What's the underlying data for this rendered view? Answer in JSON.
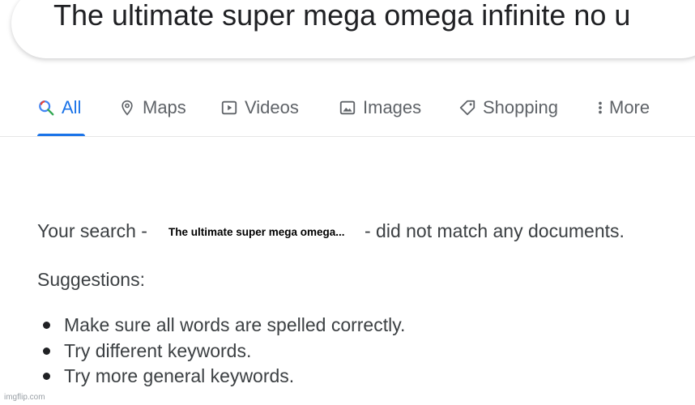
{
  "search": {
    "query": "The ultimate super mega omega infinite no u"
  },
  "tabs": [
    {
      "label": "All",
      "icon": "search-icon",
      "active": true
    },
    {
      "label": "Maps",
      "icon": "map-pin-icon"
    },
    {
      "label": "Videos",
      "icon": "play-icon"
    },
    {
      "label": "Images",
      "icon": "image-icon"
    },
    {
      "label": "Shopping",
      "icon": "tag-icon"
    },
    {
      "label": "More",
      "icon": "more-vertical-icon"
    }
  ],
  "results": {
    "prefix": "Your search -",
    "query_overlay": "The ultimate super mega omega...",
    "suffix": "- did not match any documents."
  },
  "suggestions": {
    "title": "Suggestions:",
    "items": [
      "Make sure all words are spelled correctly.",
      "Try different keywords.",
      "Try more general keywords."
    ]
  },
  "watermark": "imgflip.com",
  "colors": {
    "accent": "#1a73e8",
    "text": "#3c4043",
    "tab_text": "#5f6368"
  }
}
